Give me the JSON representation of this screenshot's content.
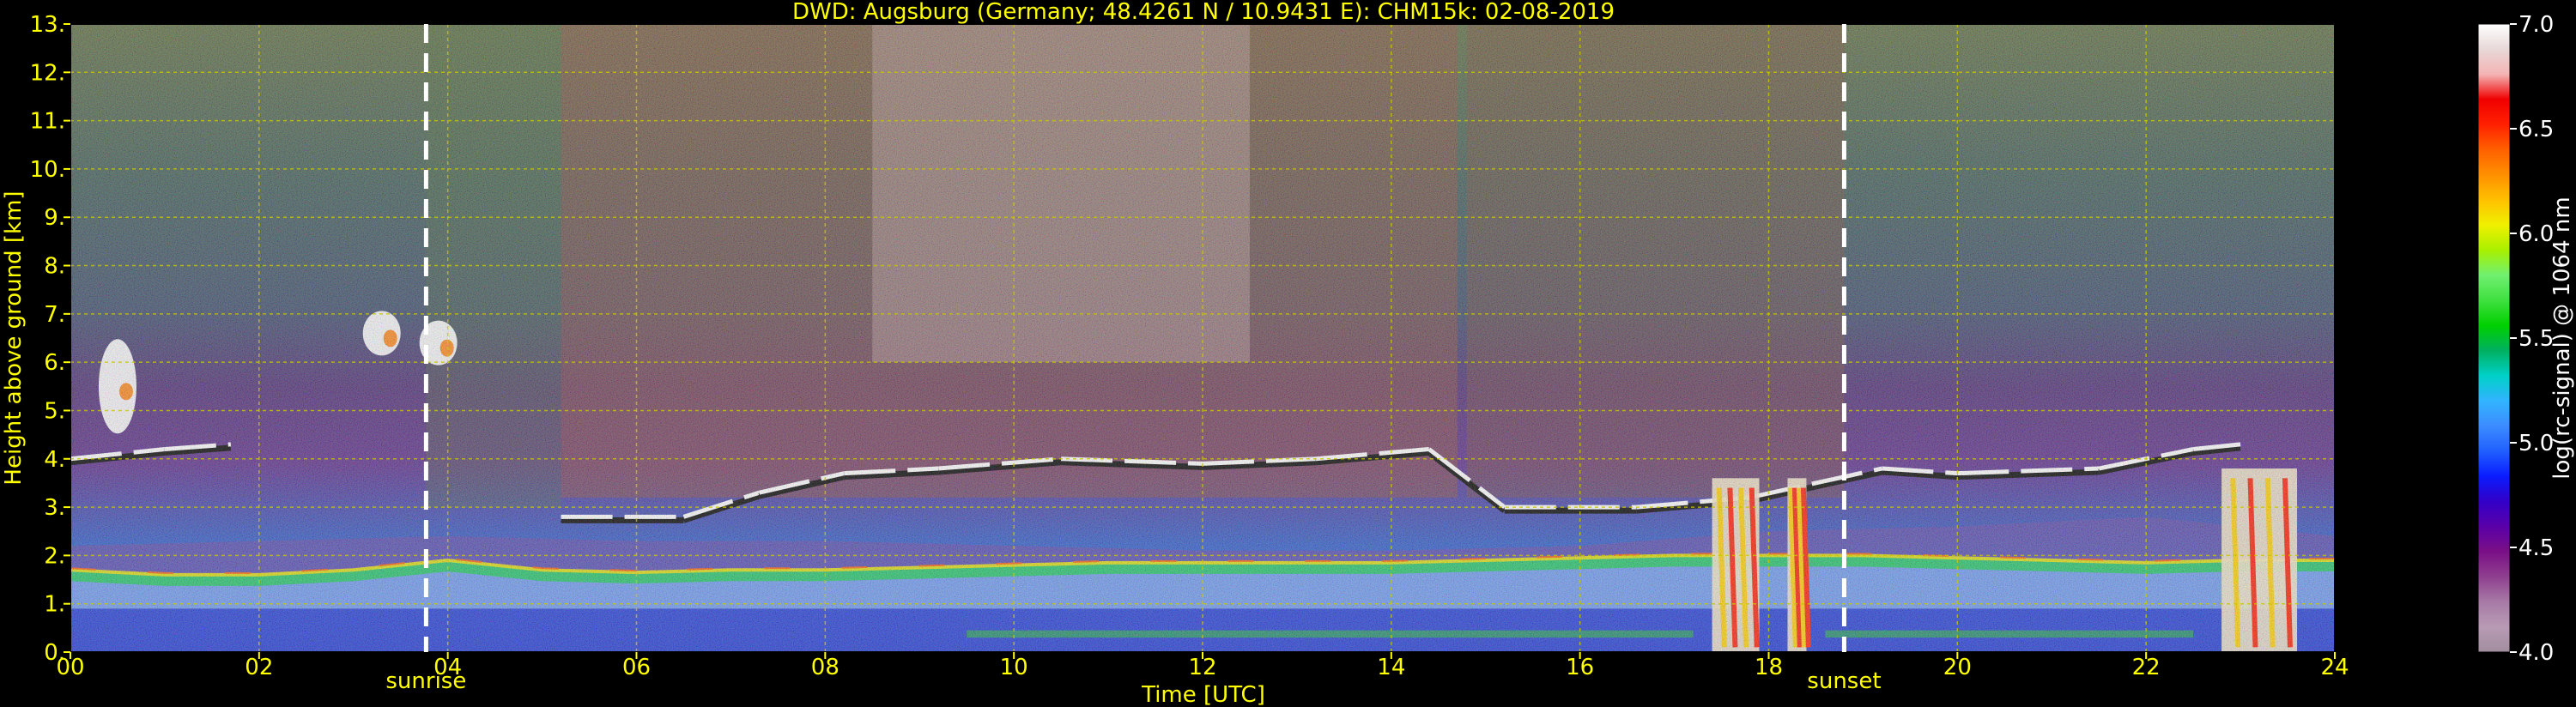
{
  "chart_data": {
    "type": "heatmap",
    "title": "DWD: Augsburg (Germany; 48.4261 N / 10.9431 E):    CHM15k: 02-08-2019",
    "xlabel": "Time [UTC]",
    "ylabel": "Height above ground [km]",
    "xlim": [
      0,
      24
    ],
    "ylim": [
      0,
      13
    ],
    "x_ticks": [
      0,
      2,
      4,
      6,
      8,
      10,
      12,
      14,
      16,
      18,
      20,
      22,
      24
    ],
    "x_tick_labels": [
      "00",
      "02",
      "04",
      "06",
      "08",
      "10",
      "12",
      "14",
      "16",
      "18",
      "20",
      "22",
      "24"
    ],
    "y_ticks": [
      0,
      1,
      2,
      3,
      4,
      5,
      6,
      7,
      8,
      9,
      10,
      11,
      12,
      13
    ],
    "y_tick_labels": [
      "0.",
      "1.",
      "2.",
      "3.",
      "4.",
      "5.",
      "6.",
      "7.",
      "8.",
      "9.",
      "10.",
      "11.",
      "12.",
      "13."
    ],
    "grid": true,
    "annotations": [
      {
        "label": "sunrise",
        "x": 3.77
      },
      {
        "label": "sunset",
        "x": 18.8
      }
    ],
    "colorbar": {
      "label": "log(rc-signal) @ 1064 nm",
      "range": [
        4.0,
        7.0
      ],
      "ticks": [
        4.0,
        4.5,
        5.0,
        5.5,
        6.0,
        6.5,
        7.0
      ],
      "tick_labels": [
        "4.0",
        "4.5",
        "5.0",
        "5.5",
        "6.0",
        "6.5",
        "7.0"
      ],
      "colors": [
        "#a28e9e",
        "#b89ab4",
        "#a77aa6",
        "#8f3f8f",
        "#7a0f86",
        "#5a00a8",
        "#3200c8",
        "#0a1cff",
        "#2060ff",
        "#3c8cff",
        "#32b4ff",
        "#00d0c8",
        "#00b060",
        "#00d000",
        "#40e040",
        "#70f070",
        "#a8f000",
        "#f0f000",
        "#ffc000",
        "#ff9000",
        "#ff6000",
        "#ff2000",
        "#f00000",
        "#f4b4b4",
        "#e8d8d8",
        "#ffffff"
      ]
    },
    "layers": {
      "boundary_layer_top": [
        [
          0,
          1.7
        ],
        [
          1,
          1.6
        ],
        [
          2,
          1.6
        ],
        [
          3,
          1.7
        ],
        [
          4,
          1.9
        ],
        [
          5,
          1.7
        ],
        [
          6,
          1.65
        ],
        [
          7,
          1.7
        ],
        [
          8,
          1.7
        ],
        [
          9,
          1.75
        ],
        [
          10,
          1.8
        ],
        [
          11,
          1.85
        ],
        [
          12,
          1.85
        ],
        [
          13,
          1.85
        ],
        [
          14,
          1.85
        ],
        [
          15,
          1.9
        ],
        [
          16,
          1.95
        ],
        [
          17,
          2.0
        ],
        [
          18,
          2.0
        ],
        [
          19,
          2.0
        ],
        [
          20,
          1.95
        ],
        [
          21,
          1.9
        ],
        [
          22,
          1.85
        ],
        [
          23,
          1.9
        ],
        [
          24,
          1.9
        ]
      ],
      "residual_layer_top": [
        [
          0,
          2.2
        ],
        [
          2,
          2.3
        ],
        [
          4,
          2.4
        ],
        [
          6,
          2.3
        ],
        [
          8,
          2.3
        ],
        [
          10,
          2.2
        ],
        [
          12,
          2.1
        ],
        [
          14,
          2.1
        ],
        [
          16,
          2.2
        ],
        [
          18,
          2.5
        ],
        [
          20,
          2.6
        ],
        [
          22,
          2.8
        ],
        [
          24,
          2.4
        ]
      ],
      "mid_level_cloud": [
        [
          0.0,
          4.0
        ],
        [
          1.0,
          4.2
        ],
        [
          1.7,
          4.3
        ],
        [
          5.2,
          2.8
        ],
        [
          6.5,
          2.8
        ],
        [
          7.3,
          3.3
        ],
        [
          8.2,
          3.7
        ],
        [
          9.2,
          3.8
        ],
        [
          10.5,
          4.0
        ],
        [
          12.0,
          3.9
        ],
        [
          13.2,
          4.0
        ],
        [
          14.4,
          4.2
        ],
        [
          15.2,
          3.0
        ],
        [
          16.6,
          3.0
        ],
        [
          17.8,
          3.2
        ],
        [
          19.2,
          3.8
        ],
        [
          20.0,
          3.7
        ],
        [
          21.5,
          3.8
        ],
        [
          22.5,
          4.2
        ],
        [
          23.0,
          4.3
        ]
      ],
      "high_cloud_patches": [
        [
          0.5,
          5.5
        ],
        [
          3.3,
          6.6
        ],
        [
          3.9,
          6.4
        ]
      ],
      "convective_columns": [
        [
          17.4,
          17.9
        ],
        [
          18.2,
          18.4
        ],
        [
          22.8,
          23.6
        ]
      ]
    }
  }
}
